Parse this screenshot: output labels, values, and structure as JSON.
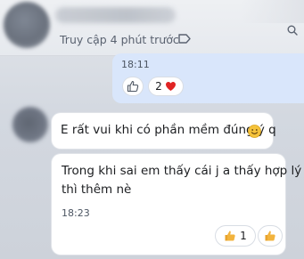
{
  "header": {
    "status": "Truy cập 4 phút trước",
    "tag_icon": "tag-icon",
    "search_icon": "search-icon"
  },
  "previous_message": {
    "time": "18:11",
    "reactions": [
      {
        "icon": "thumbs-up-outline-icon",
        "count": ""
      },
      {
        "icon": "heart-icon",
        "count": "2"
      }
    ]
  },
  "messages": [
    {
      "text": "E rất vui khi có phần mềm đúng ý q",
      "emoji": "smile-icon"
    },
    {
      "lines": [
        "Trong khi sai em thấy cái j a thấy hợp lý",
        "thì thêm nè"
      ],
      "time": "18:23",
      "reactions": [
        {
          "icon": "thumbs-up-icon",
          "count": "1"
        },
        {
          "icon": "thumbs-up-icon",
          "count": ""
        }
      ]
    }
  ],
  "colors": {
    "outgoing_bubble": "#d9e6fb",
    "incoming_bubble": "#ffffff",
    "heart": "#e02424",
    "thumb": "#f2b33d"
  }
}
